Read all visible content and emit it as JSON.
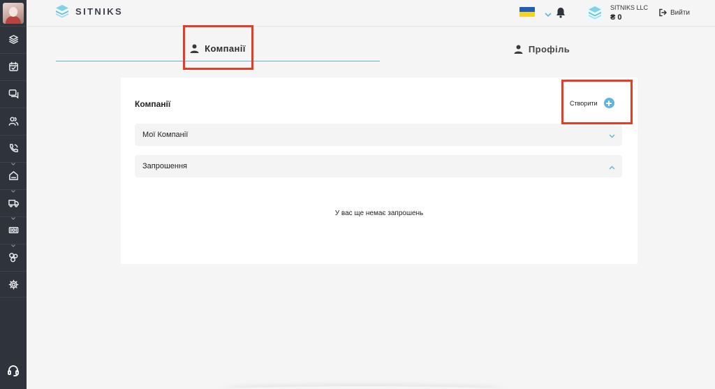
{
  "header": {
    "logo_text": "SITNIKS",
    "company_name": "SITNIKS LLC",
    "balance": "₴ 0",
    "logout_label": "Вийти"
  },
  "tabs": [
    {
      "label": "Компанії",
      "active": true
    },
    {
      "label": "Профіль",
      "active": false
    }
  ],
  "card": {
    "title": "Компанії",
    "create_label": "Створити",
    "sections": [
      {
        "label": "Мої Компанії",
        "expanded": false
      },
      {
        "label": "Запрошення",
        "expanded": true
      }
    ],
    "empty_text": "У вас ще немає запрошень"
  },
  "sidebar": {
    "items": [
      "layers-icon",
      "calendar-check-icon",
      "chat-icon",
      "users-icon",
      "phone-icon",
      "home-icon",
      "truck-icon",
      "cash-icon",
      "molecule-icon",
      "gear-icon"
    ],
    "support_icon": "headset-icon"
  },
  "colors": {
    "accent": "#5fb6d8",
    "sidebar": "#2f333c",
    "highlight": "#e43c25"
  }
}
